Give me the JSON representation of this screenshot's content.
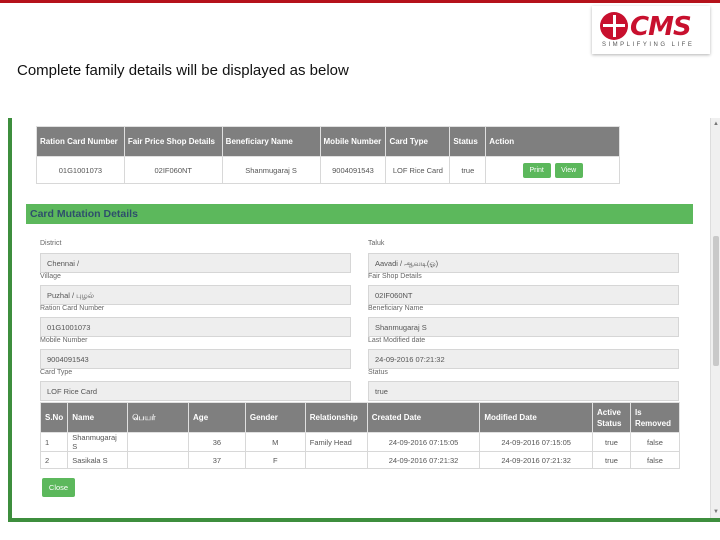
{
  "slide": {
    "caption": "Complete family details will be displayed as below",
    "logo_text": "CMS",
    "logo_tagline": "SIMPLIFYING LIFE"
  },
  "top_table": {
    "headers": [
      "Ration Card Number",
      "Fair Price Shop Details",
      "Beneficiary Name",
      "Mobile Number",
      "Card Type",
      "Status",
      "Action"
    ],
    "row": [
      "01G1001073",
      "02IF060NT",
      "Shanmugaraj S",
      "9004091543",
      "LOF Rice Card",
      "true"
    ],
    "print_label": "Print",
    "view_label": "View"
  },
  "section": {
    "title": "Card Mutation Details"
  },
  "form": {
    "district_label": "District",
    "district_value": "Chennai /",
    "taluk_label": "Taluk",
    "taluk_value": "Aavadi / ஆவடி(ஓ)",
    "village_label": "Village",
    "village_value": "Puzhal / புழல்",
    "shop_label": "Fair Shop Details",
    "shop_value": "02IF060NT",
    "ration_label": "Ration Card Number",
    "ration_value": "01G1001073",
    "beneficiary_label": "Beneficiary Name",
    "beneficiary_value": "Shanmugaraj S",
    "mobile_label": "Mobile Number",
    "mobile_value": "9004091543",
    "modified_label": "Last Modified date",
    "modified_value": "24-09-2016 07:21:32",
    "cardtype_label": "Card Type",
    "cardtype_value": "LOF Rice Card",
    "status_label": "Status",
    "status_value": "true"
  },
  "members": {
    "headers": [
      "S.No",
      "Name",
      "பெயர்",
      "Age",
      "Gender",
      "Relationship",
      "Created Date",
      "Modified Date",
      "Active Status",
      "Is Removed"
    ],
    "rows": [
      [
        "1",
        "Shanmugaraj S",
        "",
        "36",
        "M",
        "Family Head",
        "24-09-2016 07:15:05",
        "24-09-2016 07:15:05",
        "true",
        "false"
      ],
      [
        "2",
        "Sasikala S",
        "",
        "37",
        "F",
        "",
        "24-09-2016 07:21:32",
        "24-09-2016 07:21:32",
        "true",
        "false"
      ]
    ],
    "close_label": "Close"
  },
  "colors": {
    "accent_green": "#5cb85c",
    "brand_red": "#c8102e",
    "header_gray": "#7f7f7f"
  }
}
